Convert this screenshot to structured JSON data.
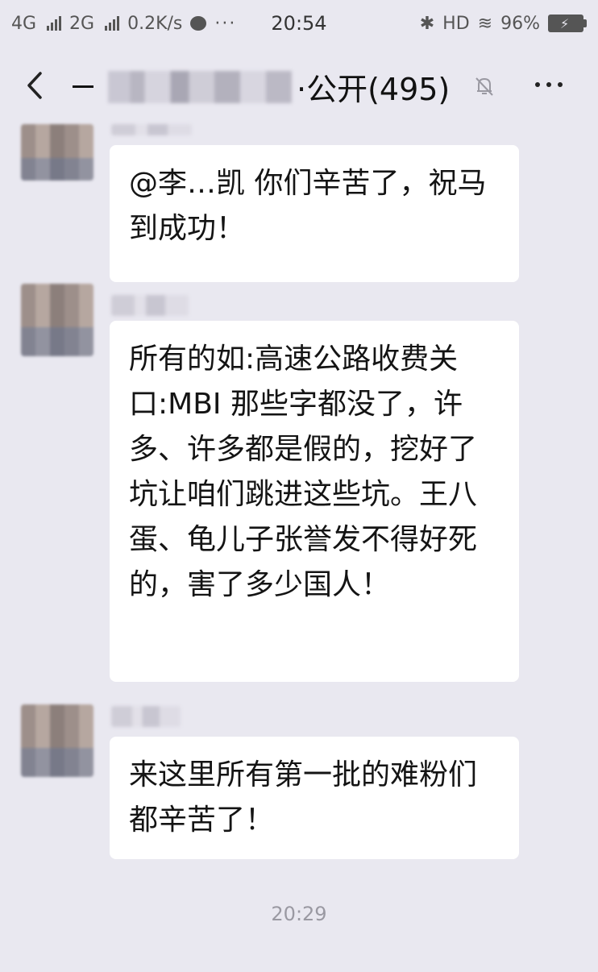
{
  "status_bar": {
    "net1": "4G",
    "net2": "2G",
    "speed": "0.2K/s",
    "dots": "···",
    "time": "20:54",
    "bt": "✱",
    "hd": "HD",
    "wifi": "≋",
    "battery": "96%"
  },
  "nav": {
    "title_suffix": "·公开(495)"
  },
  "messages": [
    {
      "text": "@李…凯  你们辛苦了，祝马到成功！"
    },
    {
      "text": "所有的如:高速公路收费关口:MBI 那些字都没了，许多、许多都是假的，挖好了坑让咱们跳进这些坑。王八蛋、龟儿子张誉发不得好死的，害了多少国人！"
    },
    {
      "text": "来这里所有第一批的难粉们都辛苦了！"
    }
  ],
  "timestamp": "20:29",
  "icons": {
    "back": "chevron-left-icon",
    "mute": "bell-off-icon",
    "more": "more-dots-icon"
  }
}
